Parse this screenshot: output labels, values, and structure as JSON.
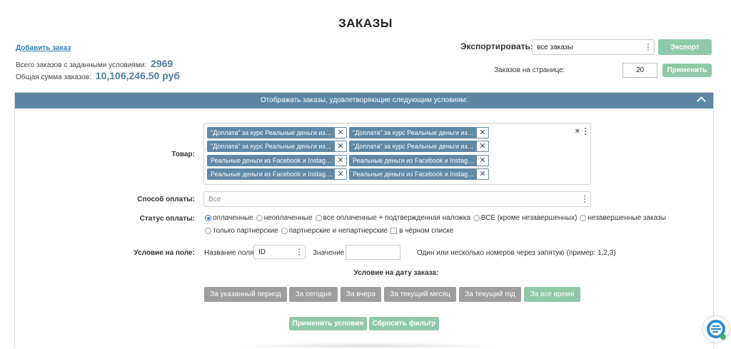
{
  "page_title": "ЗАКАЗЫ",
  "add_order_link": "Добавить заказ",
  "stats": {
    "total_label": "Всего заказов с заданными условиями:",
    "total_value": "2969",
    "sum_label": "Общая сумма заказов:",
    "sum_value": "10,106,246.50 руб"
  },
  "export": {
    "label": "Экспортировать:",
    "selected": "все заказы",
    "button": "Экспорт"
  },
  "per_page": {
    "label": "Заказов на странице:",
    "value": "20",
    "button": "Применить"
  },
  "filter_panel": {
    "header": "Отображать заказы, удовлетворяющие следующим условиям:",
    "product_label": "Товар:",
    "product_tags": [
      "\"Доплата\" за курс Реальные деньги из Facebook и Instagram",
      "\"Доплата\" за курс Реальные деньги из Facebook и Instagram",
      "\"Доплата\" за курс Реальные деньги из Facebook и Instagram",
      "\"Доплата\" за курс Реальные деньги из Facebook и Instagram",
      "Реальные деньги из Facebook и Instagram",
      "Реальные деньги из Facebook и Instagram",
      "Реальные деньги из Facebook и Instagram",
      "Реальные деньги из Facebook и Instagram"
    ],
    "tag_remove": "✕",
    "tags_clear": "×",
    "payment_method_label": "Способ оплаты:",
    "payment_method_value": "Все",
    "payment_status_label": "Статус оплаты:",
    "payment_status_options_row1": [
      "оплаченные",
      "неоплаченные",
      "все оплаченные + подтвержденная наложка",
      "ВСЕ (кроме незавершенных)",
      "незавершенные заказы"
    ],
    "payment_status_options_row2": [
      "только партнерские",
      "партнерские и непартнерские"
    ],
    "blacklist_label": "в чёрном списке",
    "field_condition_label": "Условие на поле:",
    "field_name_label": "Название поля",
    "field_name_value": "ID",
    "value_label": "Значение",
    "value_value": "",
    "hint": "Один или несколько номеров через запятую (пример: 1,2,3)",
    "date_condition_label": "Условие на дату заказа:",
    "date_buttons": [
      "За указанный период",
      "За сегодня",
      "За вчера",
      "За текущий месяц",
      "За текущий год",
      "За все время"
    ],
    "apply_button": "Применить условия",
    "reset_button": "Сбросить фильтр"
  },
  "colors": {
    "accent_blue": "#5b87a5",
    "button_green": "#8fc9a9",
    "button_gray": "#9e9e9e",
    "tag_blue": "#6189a6",
    "link_blue": "#2c7fb8"
  },
  "icons": [
    "chevron-up-icon",
    "close-icon",
    "select-dots-icon",
    "help-chat-icon"
  ]
}
